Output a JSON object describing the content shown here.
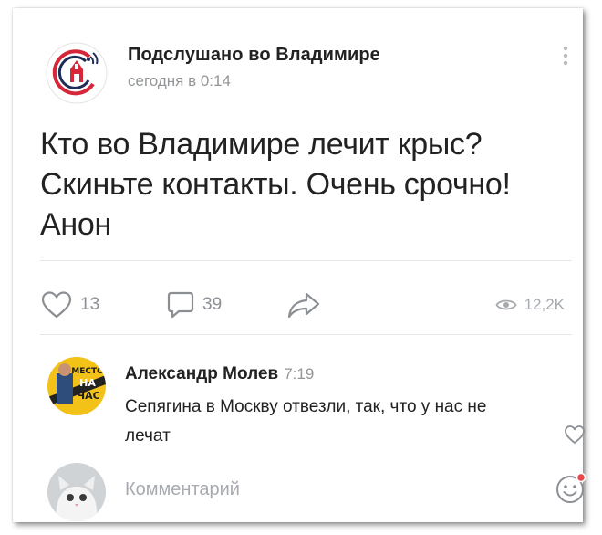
{
  "post": {
    "group_name": "Подслушано во Владимире",
    "time": "сегодня в 0:14",
    "text_lines": [
      "Кто во Владимире лечит крыс?",
      "Скиньте контакты. Очень срочно!",
      "Анон"
    ],
    "likes": "13",
    "comments": "39",
    "views": "12,2K"
  },
  "comment": {
    "author": "Александр Молев",
    "time": "7:19",
    "text": "Сепягина в Москву отвезли, так, что у нас не лечат",
    "avatar_text": [
      "МЕСТО",
      "НА",
      "ЧАС"
    ]
  },
  "composer": {
    "placeholder": "Комментарий"
  },
  "colors": {
    "logo_red": "#d6263a",
    "logo_dark": "#1e2d57",
    "icon_gray": "#8b8f94",
    "notification_red": "#e64646"
  },
  "icons": [
    "group-logo-icon",
    "more-vertical-icon",
    "like-icon",
    "comment-icon",
    "share-icon",
    "eye-icon",
    "comment-like-icon",
    "emoji-icon"
  ]
}
